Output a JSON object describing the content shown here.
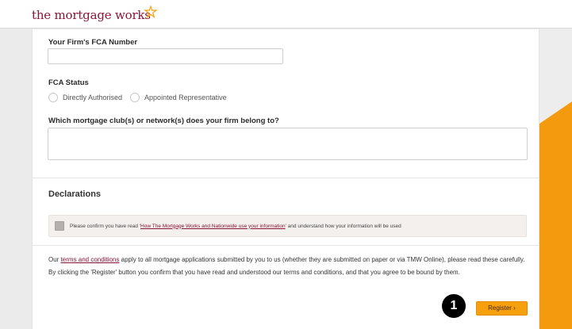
{
  "header": {
    "logo_text": "the mortgage works",
    "brand_color": "#8a1538",
    "accent_color": "#f5a00c"
  },
  "form": {
    "fca_number": {
      "label": "Your Firm's FCA Number",
      "value": ""
    },
    "fca_status": {
      "label": "FCA Status",
      "options": [
        "Directly Authorised",
        "Appointed Representative"
      ],
      "selected": null
    },
    "network": {
      "label": "Which mortgage club(s) or network(s) does your firm belong to?",
      "value": ""
    }
  },
  "declarations": {
    "title": "Declarations",
    "consent": {
      "prefix": "Please confirm you have read '",
      "link_text": "How The Mortgage Works and Nationwide use your information",
      "suffix": "' and understand how your information will be used",
      "checked": false
    }
  },
  "terms": {
    "prefix": "Our ",
    "link_text": "terms and conditions",
    "suffix": " apply to all mortgage applications submitted by you to us (whether they are submitted on paper or via TMW Online), please read these carefully. By clicking the 'Register' button you confirm that you have read and understood our terms and conditions, and that you agree to be bound by them."
  },
  "actions": {
    "register_label": "Register",
    "register_icon": "chevron-right-icon",
    "step_number": "1"
  }
}
